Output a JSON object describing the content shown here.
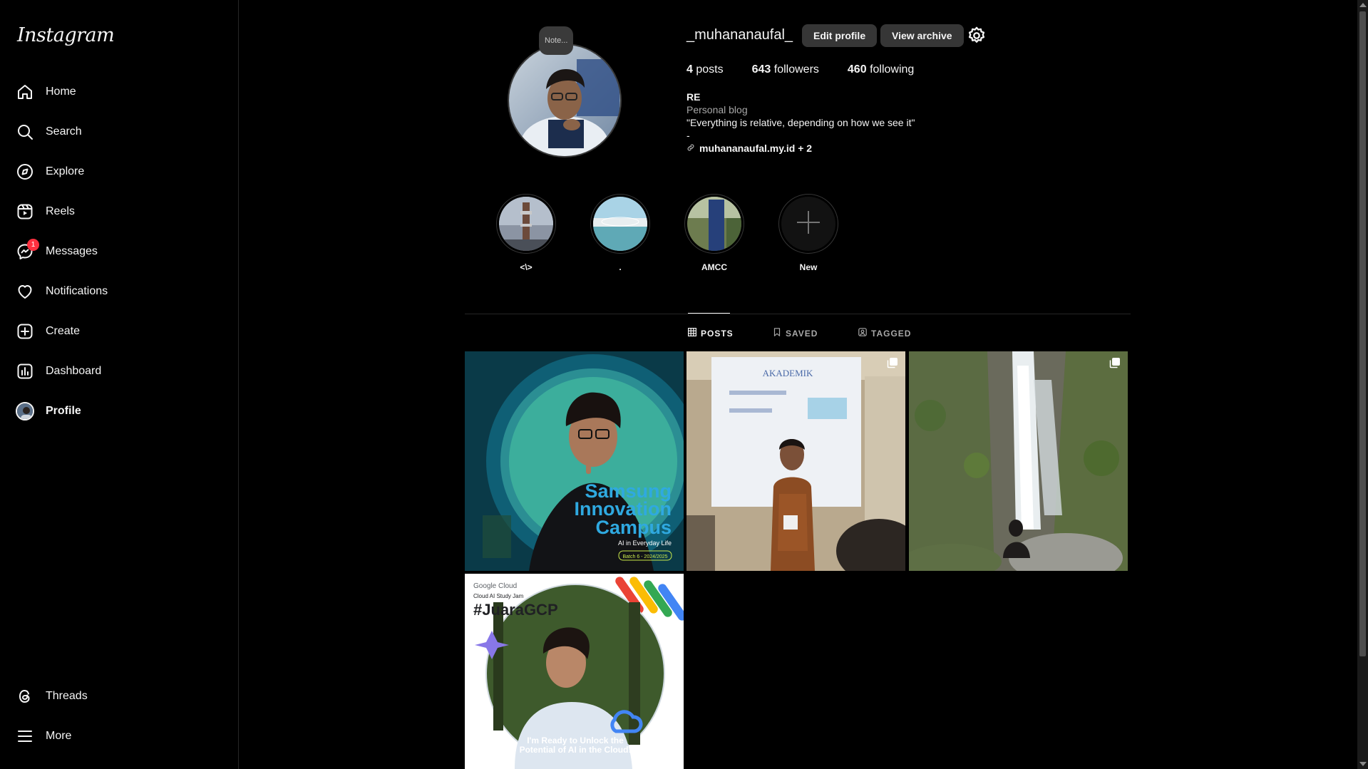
{
  "sidebar": {
    "logo": "Instagram",
    "items": [
      {
        "label": "Home",
        "icon": "home-icon"
      },
      {
        "label": "Search",
        "icon": "search-icon"
      },
      {
        "label": "Explore",
        "icon": "compass-icon"
      },
      {
        "label": "Reels",
        "icon": "reels-icon"
      },
      {
        "label": "Messages",
        "icon": "messenger-icon",
        "badge": "1"
      },
      {
        "label": "Notifications",
        "icon": "heart-icon"
      },
      {
        "label": "Create",
        "icon": "plus-square-icon"
      },
      {
        "label": "Dashboard",
        "icon": "dashboard-icon"
      },
      {
        "label": "Profile",
        "icon": "avatar"
      }
    ],
    "bottom_items": [
      {
        "label": "Threads",
        "icon": "threads-icon"
      },
      {
        "label": "More",
        "icon": "menu-icon"
      }
    ]
  },
  "profile": {
    "note": "Note...",
    "username": "_muhananaufal_",
    "edit_profile_label": "Edit profile",
    "view_archive_label": "View archive",
    "stats": {
      "posts_count": "4",
      "posts_label": "posts",
      "followers_count": "643",
      "followers_label": "followers",
      "following_count": "460",
      "following_label": "following"
    },
    "bio": {
      "name": "RE",
      "category": "Personal blog",
      "text": "\"Everything is relative, depending on how we see it\"",
      "extra": "-",
      "link": "muhananaufal.my.id + 2"
    }
  },
  "highlights": [
    {
      "label": "<\\>"
    },
    {
      "label": "."
    },
    {
      "label": "AMCC"
    },
    {
      "label": "New"
    }
  ],
  "tabs": [
    {
      "label": "POSTS",
      "icon": "grid-icon",
      "active": true
    },
    {
      "label": "SAVED",
      "icon": "bookmark-icon",
      "active": false
    },
    {
      "label": "TAGGED",
      "icon": "tag-icon",
      "active": false
    }
  ],
  "posts": [
    {
      "title": "Samsung Innovation Campus",
      "lines": [
        "Samsung",
        "Innovation",
        "Campus"
      ],
      "caption": "AI in Everyday Life",
      "batch": "Batch 6 - 2024/2025",
      "multi": false
    },
    {
      "title": "AKADEMIK",
      "multi": true
    },
    {
      "title": "waterfall",
      "multi": true
    },
    {
      "brand": "Google Cloud",
      "sub": "Cloud AI Study Jam",
      "hashtag": "#JuaraGCP",
      "tagline": "I'm Ready to Unlock the Potential of AI in the Cloud!",
      "multi": false
    }
  ],
  "colors": {
    "accent": "#0095f6",
    "badge": "#ff3040",
    "button_bg": "#363636"
  }
}
